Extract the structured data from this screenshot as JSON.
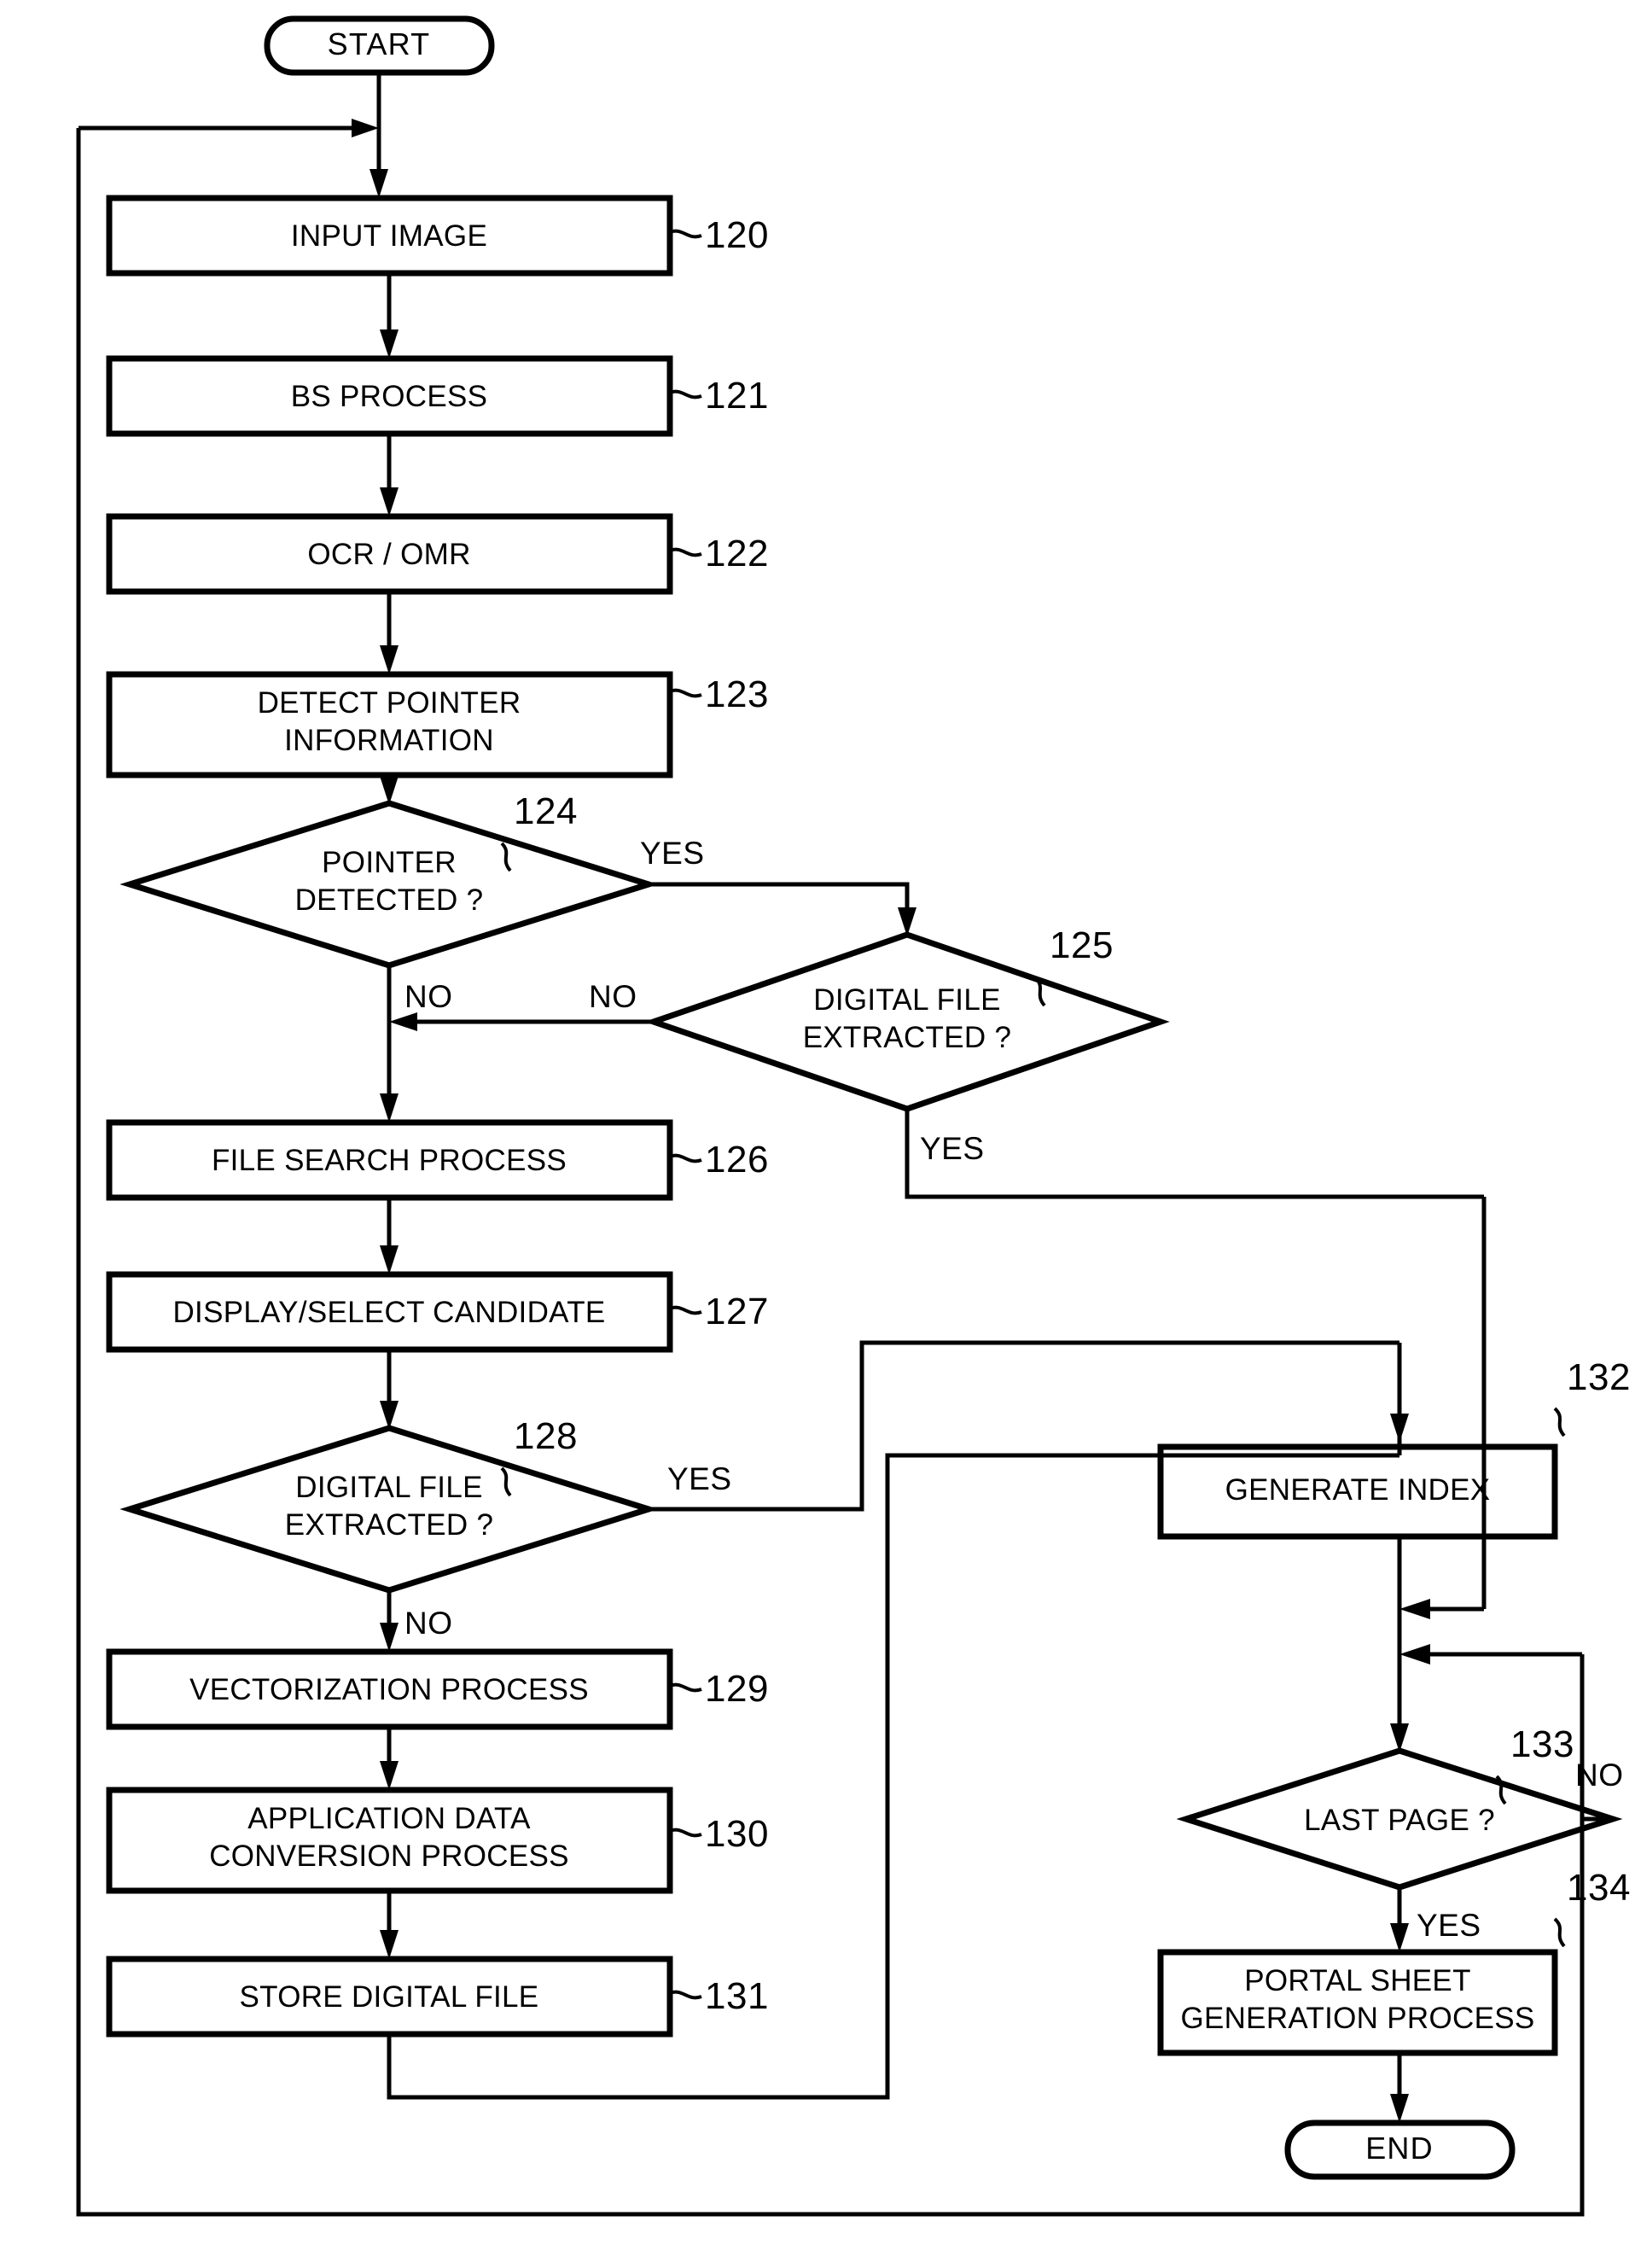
{
  "diagram": {
    "type": "flowchart",
    "orientation": "vertical",
    "background_color": "#ffffff",
    "line_color": "#000000"
  },
  "terminators": {
    "start": "START",
    "end": "END"
  },
  "process_boxes": [
    {
      "ref": "120",
      "ref_display": "~120",
      "label": "INPUT IMAGE"
    },
    {
      "ref": "121",
      "ref_display": "~121",
      "label": "BS PROCESS"
    },
    {
      "ref": "122",
      "ref_display": "~122",
      "label": "OCR / OMR"
    },
    {
      "ref": "123",
      "ref_display": "~123",
      "label_line1": "DETECT POINTER",
      "label_line2": "INFORMATION"
    },
    {
      "ref": "126",
      "ref_display": "~126",
      "label": "FILE SEARCH PROCESS"
    },
    {
      "ref": "127",
      "ref_display": "~127",
      "label": "DISPLAY/SELECT CANDIDATE"
    },
    {
      "ref": "129",
      "ref_display": "~129",
      "label": "VECTORIZATION PROCESS"
    },
    {
      "ref": "130",
      "ref_display": "~130",
      "label_line1": "APPLICATION DATA",
      "label_line2": "CONVERSION PROCESS"
    },
    {
      "ref": "131",
      "ref_display": "~131",
      "label": "STORE DIGITAL FILE"
    },
    {
      "ref": "132",
      "ref_display": "132",
      "label": "GENERATE INDEX"
    },
    {
      "ref": "134",
      "ref_display": "134",
      "label_line1": "PORTAL SHEET",
      "label_line2": "GENERATION PROCESS"
    }
  ],
  "decisions": [
    {
      "ref": "124",
      "ref_display": "124",
      "label_line1": "POINTER",
      "label_line2": "DETECTED ?",
      "yes_label": "YES",
      "no_label": "NO"
    },
    {
      "ref": "125",
      "ref_display": "125",
      "label_line1": "DIGITAL FILE",
      "label_line2": "EXTRACTED ?",
      "yes_label": "YES",
      "no_label": "NO"
    },
    {
      "ref": "128",
      "ref_display": "128",
      "label_line1": "DIGITAL FILE",
      "label_line2": "EXTRACTED ?",
      "yes_label": "YES",
      "no_label": "NO"
    },
    {
      "ref": "133",
      "ref_display": "133",
      "label": "LAST PAGE ?",
      "yes_label": "YES",
      "no_label": "NO"
    }
  ],
  "branch_labels": {
    "d124_yes": "YES",
    "d124_no": "NO",
    "d125_no": "NO",
    "d125_yes": "YES",
    "d128_yes": "YES",
    "d128_no": "NO",
    "d133_no": "NO",
    "d133_yes": "YES"
  },
  "reference_numerals": [
    "120",
    "121",
    "122",
    "123",
    "124",
    "125",
    "126",
    "127",
    "128",
    "129",
    "130",
    "131",
    "132",
    "133",
    "134"
  ]
}
